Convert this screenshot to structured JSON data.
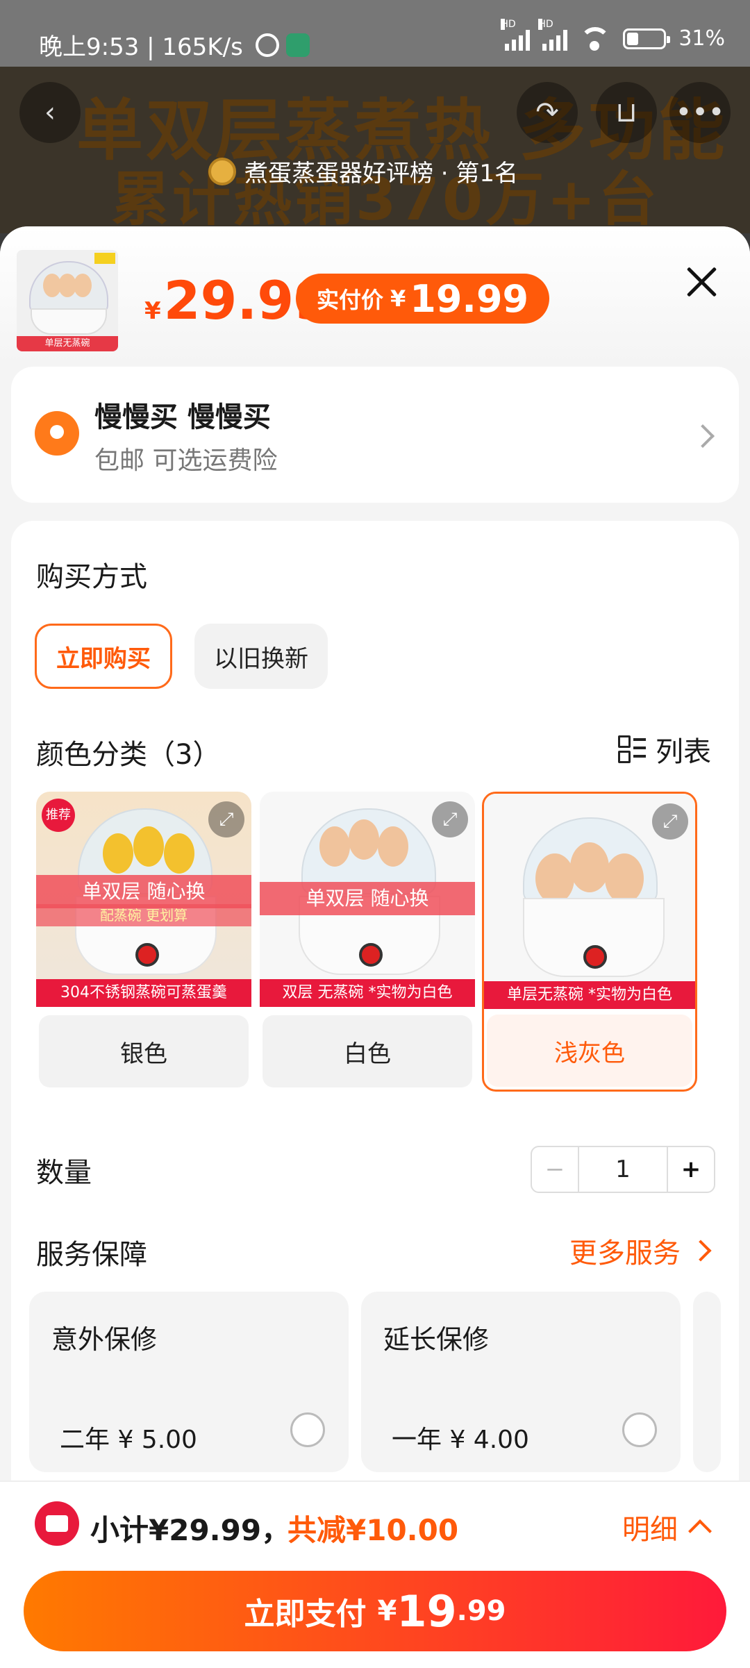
{
  "status_bar": {
    "time": "晚上9:53 | 165K/s",
    "signal_label": "HD",
    "battery": "31%"
  },
  "background": {
    "headline1": "单双层蒸煮热 多功能",
    "headline2": "累计热销370万+台",
    "rank_text": "煮蛋蒸蛋器好评榜 · 第1名"
  },
  "sheet": {
    "price_currency": "¥",
    "price_value": "29.99",
    "realpay_label": "实付价",
    "realpay_currency": "¥",
    "realpay_value": "19.99",
    "thumb_strip": "单层无蒸碗"
  },
  "address": {
    "name": "慢慢买 慢慢买",
    "sub": "包邮  可选运费险"
  },
  "purchase": {
    "title": "购买方式",
    "options": [
      "立即购买",
      "以旧换新"
    ],
    "selected": 0
  },
  "color": {
    "title": "颜色分类（3）",
    "list_label": "列表",
    "variants": [
      {
        "label": "银色",
        "tag": "推荐",
        "band": "单双层 随心换",
        "band2": "配蒸碗 更划算",
        "strip": "304不锈钢蒸碗可蒸蛋羹"
      },
      {
        "label": "白色",
        "band": "单双层 随心换",
        "strip": "双层 无蒸碗 *实物为白色"
      },
      {
        "label": "浅灰色",
        "strip": "单层无蒸碗 *实物为白色"
      }
    ],
    "selected": 2
  },
  "quantity": {
    "title": "数量",
    "minus": "−",
    "value": "1",
    "plus": "+"
  },
  "service": {
    "title": "服务保障",
    "more": "更多服务",
    "cards": [
      {
        "title": "意外保修",
        "price": "二年 ¥ 5.00"
      },
      {
        "title": "延长保修",
        "price": "一年 ¥ 4.00"
      }
    ]
  },
  "bottom": {
    "subtotal": "小计¥29.99，",
    "discount": "共减¥10.00",
    "detail": "明细",
    "pay_label": "立即支付",
    "pay_currency": "¥",
    "pay_int": "19",
    "pay_dec": ".99"
  }
}
